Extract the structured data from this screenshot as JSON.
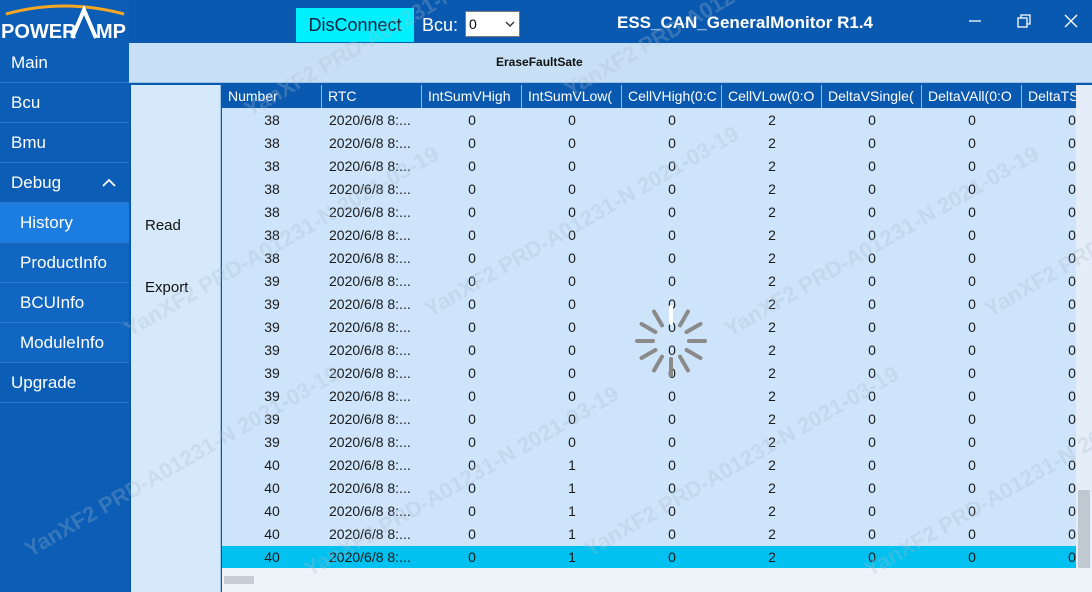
{
  "app": {
    "title": "ESS_CAN_GeneralMonitor R1.4",
    "logo_text": "POWERAMP",
    "disconnect_label": "DisConnect",
    "bcu_label": "Bcu:",
    "bcu_value": "0",
    "erase_label": "EraseFaultSate",
    "brand_color": "#0a59b0",
    "accent_color": "#00f0ff"
  },
  "sidebar": {
    "items": [
      {
        "label": "Main"
      },
      {
        "label": "Bcu"
      },
      {
        "label": "Bmu"
      },
      {
        "label": "Debug"
      },
      {
        "label": "History"
      },
      {
        "label": "ProductInfo"
      },
      {
        "label": "BCUInfo"
      },
      {
        "label": "ModuleInfo"
      },
      {
        "label": "Upgrade"
      }
    ]
  },
  "actions": {
    "read_label": "Read",
    "export_label": "Export"
  },
  "table": {
    "columns": [
      "Number",
      "RTC",
      "IntSumVHigh",
      "IntSumVLow(",
      "CellVHigh(0:C",
      "CellVLow(0:O",
      "DeltaVSingle(",
      "DeltaVAll(0:O",
      "DeltaTS"
    ],
    "rows": [
      [
        "38",
        "2020/6/8 8:...",
        "0",
        "0",
        "0",
        "2",
        "0",
        "0",
        "0"
      ],
      [
        "38",
        "2020/6/8 8:...",
        "0",
        "0",
        "0",
        "2",
        "0",
        "0",
        "0"
      ],
      [
        "38",
        "2020/6/8 8:...",
        "0",
        "0",
        "0",
        "2",
        "0",
        "0",
        "0"
      ],
      [
        "38",
        "2020/6/8 8:...",
        "0",
        "0",
        "0",
        "2",
        "0",
        "0",
        "0"
      ],
      [
        "38",
        "2020/6/8 8:...",
        "0",
        "0",
        "0",
        "2",
        "0",
        "0",
        "0"
      ],
      [
        "38",
        "2020/6/8 8:...",
        "0",
        "0",
        "0",
        "2",
        "0",
        "0",
        "0"
      ],
      [
        "38",
        "2020/6/8 8:...",
        "0",
        "0",
        "0",
        "2",
        "0",
        "0",
        "0"
      ],
      [
        "39",
        "2020/6/8 8:...",
        "0",
        "0",
        "0",
        "2",
        "0",
        "0",
        "0"
      ],
      [
        "39",
        "2020/6/8 8:...",
        "0",
        "0",
        "0",
        "2",
        "0",
        "0",
        "0"
      ],
      [
        "39",
        "2020/6/8 8:...",
        "0",
        "0",
        "0",
        "2",
        "0",
        "0",
        "0"
      ],
      [
        "39",
        "2020/6/8 8:...",
        "0",
        "0",
        "0",
        "2",
        "0",
        "0",
        "0"
      ],
      [
        "39",
        "2020/6/8 8:...",
        "0",
        "0",
        "0",
        "2",
        "0",
        "0",
        "0"
      ],
      [
        "39",
        "2020/6/8 8:...",
        "0",
        "0",
        "0",
        "2",
        "0",
        "0",
        "0"
      ],
      [
        "39",
        "2020/6/8 8:...",
        "0",
        "0",
        "0",
        "2",
        "0",
        "0",
        "0"
      ],
      [
        "39",
        "2020/6/8 8:...",
        "0",
        "0",
        "0",
        "2",
        "0",
        "0",
        "0"
      ],
      [
        "40",
        "2020/6/8 8:...",
        "0",
        "1",
        "0",
        "2",
        "0",
        "0",
        "0"
      ],
      [
        "40",
        "2020/6/8 8:...",
        "0",
        "1",
        "0",
        "2",
        "0",
        "0",
        "0"
      ],
      [
        "40",
        "2020/6/8 8:...",
        "0",
        "1",
        "0",
        "2",
        "0",
        "0",
        "0"
      ],
      [
        "40",
        "2020/6/8 8:...",
        "0",
        "1",
        "0",
        "2",
        "0",
        "0",
        "0"
      ],
      [
        "40",
        "2020/6/8 8:...",
        "0",
        "1",
        "0",
        "2",
        "0",
        "0",
        "0"
      ]
    ],
    "selected_row": 19,
    "selected_color": "#00c1ef"
  },
  "watermarks": [
    "YanXF2 PRD-A01231-N 2021-03-19"
  ]
}
